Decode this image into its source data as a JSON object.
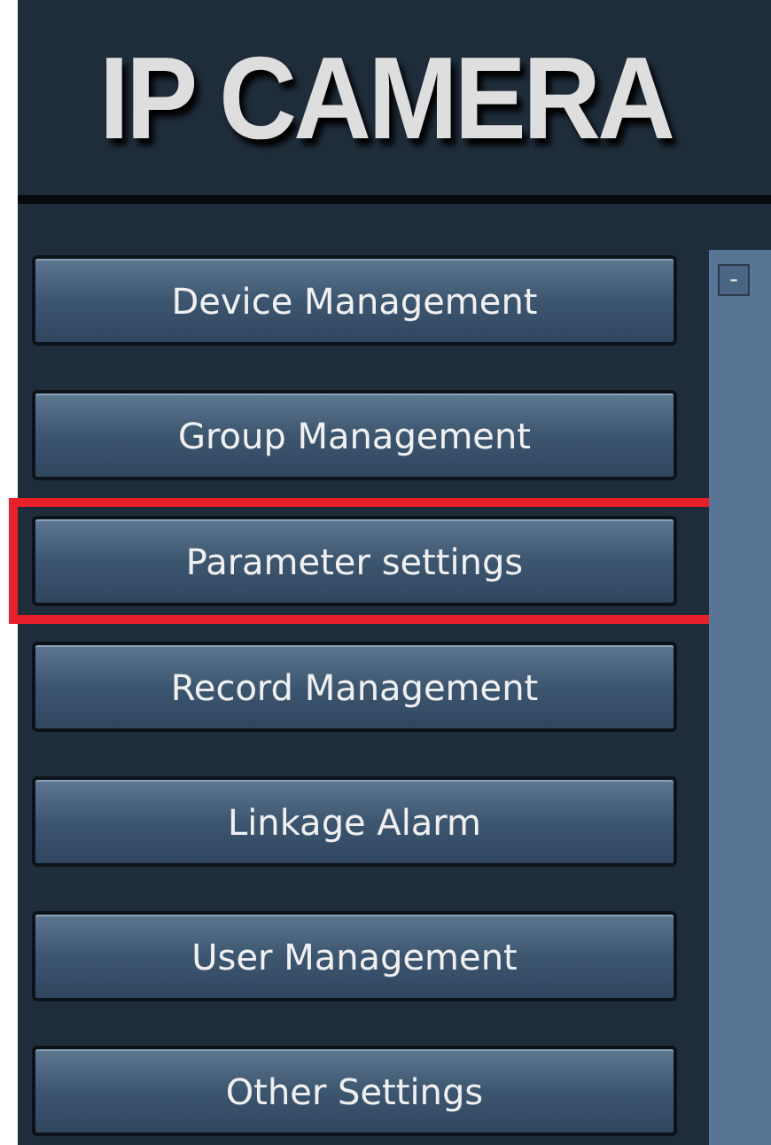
{
  "header": {
    "title": "IP CAMERA"
  },
  "menu": [
    {
      "label": "Device Management",
      "highlighted": false
    },
    {
      "label": "Group Management",
      "highlighted": false
    },
    {
      "label": "Parameter settings",
      "highlighted": true
    },
    {
      "label": "Record Management",
      "highlighted": false
    },
    {
      "label": "Linkage Alarm",
      "highlighted": false
    },
    {
      "label": "User Management",
      "highlighted": false
    },
    {
      "label": "Other Settings",
      "highlighted": false
    }
  ],
  "side_panel": {
    "collapse_glyph": "-"
  }
}
